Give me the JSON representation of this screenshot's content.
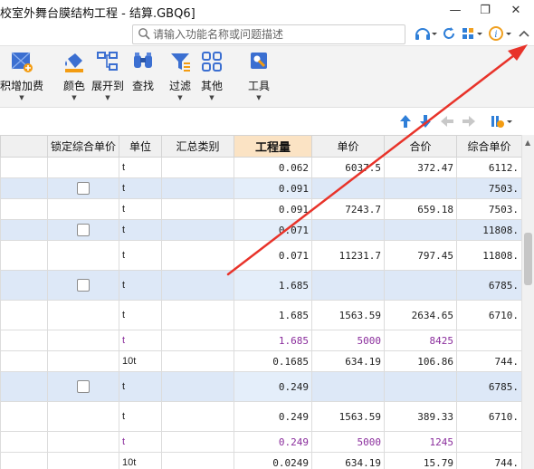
{
  "window": {
    "title": "校室外舞台膜结构工程 - 结算.GBQ6]",
    "minimize": "—",
    "restore": "❐",
    "close": "✕"
  },
  "search": {
    "placeholder": "请输入功能名称或问题描述"
  },
  "ribbon": {
    "items": [
      {
        "label": "积增加费",
        "icon": "cost-grid-icon"
      },
      {
        "label": "颜色",
        "icon": "paint-bucket-icon"
      },
      {
        "label": "展开到",
        "icon": "tree-expand-icon"
      },
      {
        "label": "查找",
        "icon": "binoculars-icon"
      },
      {
        "label": "过滤",
        "icon": "filter-funnel-icon"
      },
      {
        "label": "其他",
        "icon": "grid-squares-icon"
      },
      {
        "label": "工具",
        "icon": "tools-icon"
      }
    ]
  },
  "table": {
    "headers": [
      "锁定综合单价",
      "单位",
      "汇总类别",
      "工程量",
      "单价",
      "合价",
      "综合单价"
    ],
    "rows": [
      {
        "band": false,
        "purple": false,
        "checkbox": false,
        "unit": "t",
        "category": "",
        "qty": "0.062",
        "price": "6037.5",
        "total": "372.47",
        "unit_price": "6112."
      },
      {
        "band": true,
        "purple": false,
        "checkbox": true,
        "unit": "t",
        "category": "",
        "qty": "0.091",
        "price": "",
        "total": "",
        "unit_price": "7503."
      },
      {
        "band": false,
        "purple": false,
        "checkbox": false,
        "unit": "t",
        "category": "",
        "qty": "0.091",
        "price": "7243.7",
        "total": "659.18",
        "unit_price": "7503."
      },
      {
        "band": true,
        "purple": false,
        "checkbox": true,
        "unit": "t",
        "category": "",
        "qty": "0.071",
        "price": "",
        "total": "",
        "unit_price": "11808."
      },
      {
        "band": false,
        "purple": false,
        "checkbox": false,
        "unit": "t",
        "category": "",
        "qty": "0.071",
        "price": "11231.7",
        "total": "797.45",
        "unit_price": "11808."
      },
      {
        "band": true,
        "purple": false,
        "checkbox": true,
        "unit": "t",
        "category": "",
        "qty": "1.685",
        "price": "",
        "total": "",
        "unit_price": "6785."
      },
      {
        "band": false,
        "purple": false,
        "checkbox": false,
        "unit": "t",
        "category": "",
        "qty": "1.685",
        "price": "1563.59",
        "total": "2634.65",
        "unit_price": "6710."
      },
      {
        "band": false,
        "purple": true,
        "checkbox": false,
        "unit": "t",
        "category": "",
        "qty": "1.685",
        "price": "5000",
        "total": "8425",
        "unit_price": ""
      },
      {
        "band": false,
        "purple": false,
        "checkbox": false,
        "unit": "10t",
        "category": "",
        "qty": "0.1685",
        "price": "634.19",
        "total": "106.86",
        "unit_price": "744."
      },
      {
        "band": true,
        "purple": false,
        "checkbox": true,
        "unit": "t",
        "category": "",
        "qty": "0.249",
        "price": "",
        "total": "",
        "unit_price": "6785."
      },
      {
        "band": false,
        "purple": false,
        "checkbox": false,
        "unit": "t",
        "category": "",
        "qty": "0.249",
        "price": "1563.59",
        "total": "389.33",
        "unit_price": "6710."
      },
      {
        "band": false,
        "purple": true,
        "checkbox": false,
        "unit": "t",
        "category": "",
        "qty": "0.249",
        "price": "5000",
        "total": "1245",
        "unit_price": ""
      },
      {
        "band": false,
        "purple": false,
        "checkbox": false,
        "unit": "10t",
        "category": "",
        "qty": "0.0249",
        "price": "634.19",
        "total": "15.79",
        "unit_price": "744."
      }
    ]
  },
  "colors": {
    "accent_blue": "#2f7fd8",
    "selected_header": "#fbe3c4",
    "band_row": "#dde8f7",
    "annotation_arrow": "#e8332a",
    "purple_text": "#8a2d9c"
  }
}
